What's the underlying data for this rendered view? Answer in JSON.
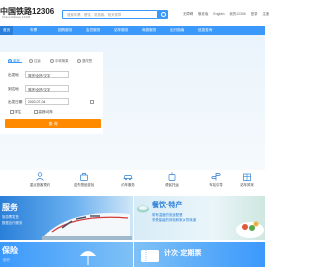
{
  "header": {
    "logo": "中国铁路12306",
    "logo_sub": "China Railway 12306",
    "search_placeholder": "搜索车票、餐饮、常旅客、相关规章",
    "links": [
      "无障碍",
      "敬老版",
      "English",
      "我的12306",
      "登录",
      "注册"
    ]
  },
  "nav": {
    "items": [
      "首页",
      "车票",
      "团购服务",
      "会员服务",
      "站车服务",
      "商旅服务",
      "出行指南",
      "信息查询"
    ]
  },
  "booking": {
    "tabs": [
      "单程",
      "往返",
      "中转换乘",
      "退改签"
    ],
    "from_label": "出发地",
    "from_value": "简拼/全拼/汉字",
    "to_label": "到达地",
    "to_value": "简拼/全拼/汉字",
    "date_label": "出发日期",
    "date_value": "2020-07-04",
    "options": [
      "学生",
      "高铁/动车"
    ],
    "query_label": "查 询"
  },
  "services": [
    "重点旅客预约",
    "遗失物品查找",
    "约车服务",
    "便民托运",
    "车站引导",
    "站车风采"
  ],
  "promos": [
    {
      "title": "服务",
      "sub1": "旅游票发售",
      "sub2": "数据出行服务"
    },
    {
      "title": "餐饮·特产",
      "sub1": "带有温度的旅途配餐",
      "sub2": "享受星级的体验和家乡的味道"
    },
    {
      "title": "保险",
      "sub1": "·出行"
    },
    {
      "title": "计次·定期票",
      "sub1": ""
    }
  ],
  "colors": {
    "brand_blue": "#3b99fc",
    "query_orange": "#ff8a00"
  }
}
